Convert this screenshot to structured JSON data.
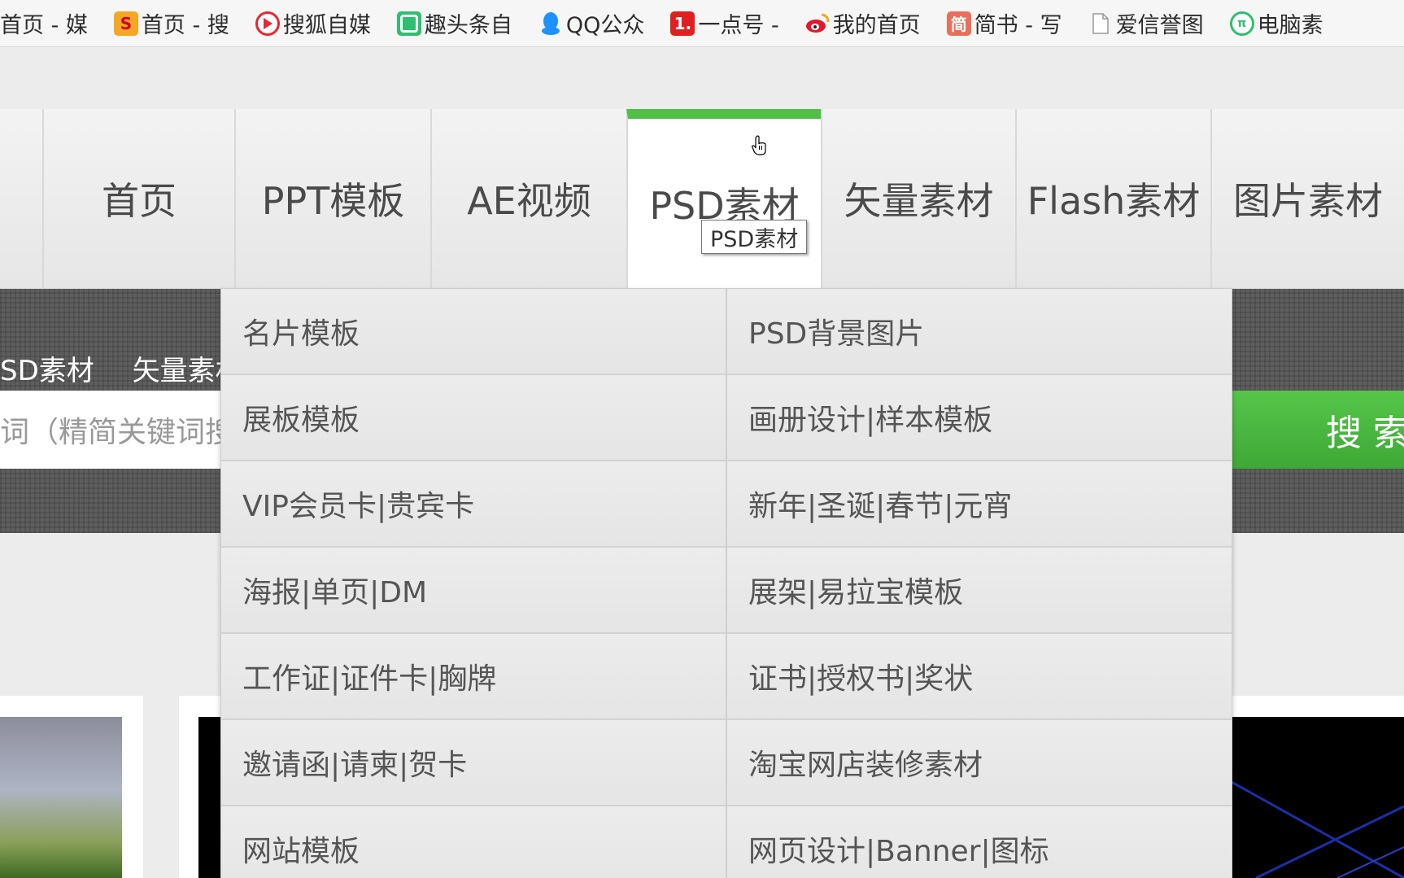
{
  "bookmarks": [
    {
      "label": "首页 - 媒",
      "icon": "none",
      "color": ""
    },
    {
      "label": "首页 - 搜",
      "icon": "sogou-icon",
      "color": "#f5a623"
    },
    {
      "label": "搜狐自媒",
      "icon": "sohu-icon",
      "color": "#e8272f"
    },
    {
      "label": "趣头条自",
      "icon": "qutoutiao-icon",
      "color": "#2fbf71"
    },
    {
      "label": "QQ公众",
      "icon": "qq-icon",
      "color": "#1e90ff"
    },
    {
      "label": "一点号 -",
      "icon": "yidian-icon",
      "color": "#e02020"
    },
    {
      "label": "我的首页",
      "icon": "weibo-icon",
      "color": "#e6162d"
    },
    {
      "label": "简书 - 写",
      "icon": "jianshu-icon",
      "color": "#ea6f5a"
    },
    {
      "label": "爱信誉图",
      "icon": "page-icon",
      "color": "#bbbbbb"
    },
    {
      "label": "电脑素",
      "icon": "diannao-icon",
      "color": "#2fbf71"
    }
  ],
  "nav": {
    "items": [
      "首页",
      "PPT模板",
      "AE视频",
      "PSD素材",
      "矢量素材",
      "Flash素材",
      "图片素材"
    ],
    "active_index": 3,
    "tooltip": "PSD素材",
    "accent_color": "#4fbf45"
  },
  "subnav": {
    "items": [
      "SD素材",
      "矢量素材"
    ]
  },
  "search": {
    "placeholder": "词（精简关键词搜",
    "button_label": "搜 索"
  },
  "dropdown": {
    "left": [
      "名片模板",
      "展板模板",
      "VIP会员卡|贵宾卡",
      "海报|单页|DM",
      "工作证|证件卡|胸牌",
      "邀请函|请柬|贺卡",
      "网站模板"
    ],
    "right": [
      "PSD背景图片",
      "画册设计|样本模板",
      "新年|圣诞|春节|元宵",
      "展架|易拉宝模板",
      "证书|授权书|奖状",
      "淘宝网店装修素材",
      "网页设计|Banner|图标"
    ]
  }
}
